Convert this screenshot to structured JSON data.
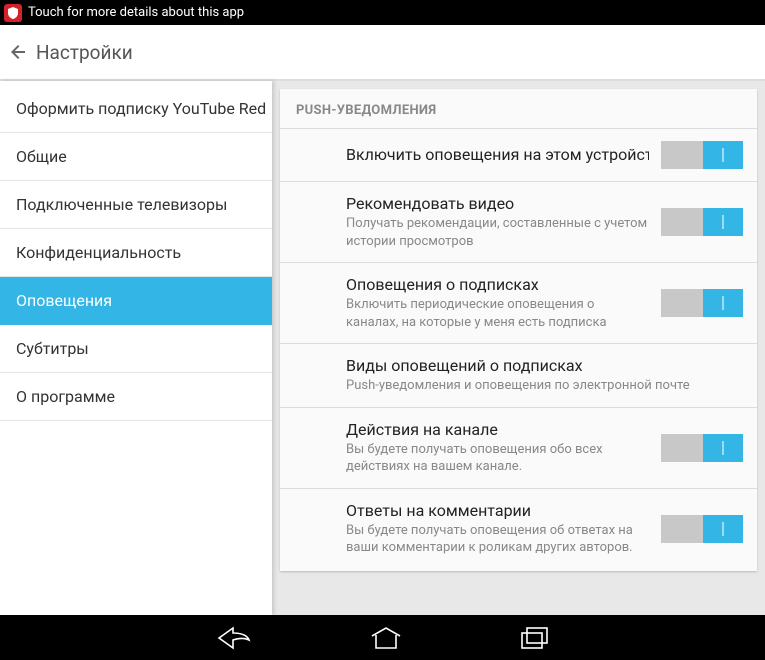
{
  "status_bar": {
    "text": "Touch for more details about this app"
  },
  "header": {
    "title": "Настройки"
  },
  "sidebar": {
    "items": [
      {
        "label": "Оформить подписку YouTube Red",
        "selected": false
      },
      {
        "label": "Общие",
        "selected": false
      },
      {
        "label": "Подключенные телевизоры",
        "selected": false
      },
      {
        "label": "Конфиденциальность",
        "selected": false
      },
      {
        "label": "Оповещения",
        "selected": true
      },
      {
        "label": "Субтитры",
        "selected": false
      },
      {
        "label": "О программе",
        "selected": false
      }
    ]
  },
  "main": {
    "section_header": "PUSH-УВЕДОМЛЕНИЯ",
    "settings": [
      {
        "title": "Включить оповещения на этом устройстве",
        "sub": "",
        "toggle": true
      },
      {
        "title": "Рекомендовать видео",
        "sub": "Получать рекомендации, составленные с учетом истории просмотров",
        "toggle": true
      },
      {
        "title": "Оповещения о подписках",
        "sub": "Включить периодические оповещения о каналах, на которые у меня есть подписка",
        "toggle": true
      },
      {
        "title": "Виды оповещений о подписках",
        "sub": "Push-уведомления и оповещения по электронной почте",
        "toggle": false
      },
      {
        "title": "Действия на канале",
        "sub": "Вы будете получать оповещения обо всех действиях на вашем канале.",
        "toggle": true
      },
      {
        "title": "Ответы на комментарии",
        "sub": "Вы будете получать оповещения об ответах на ваши комментарии к роликам других авторов.",
        "toggle": true
      }
    ]
  }
}
